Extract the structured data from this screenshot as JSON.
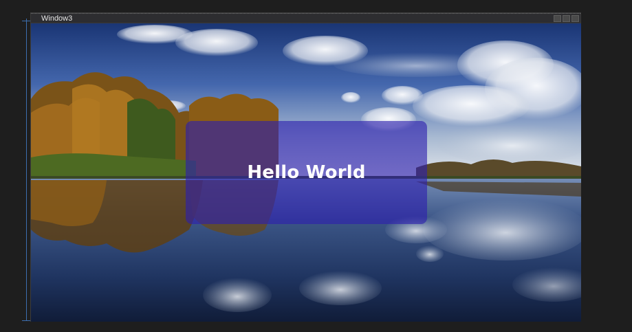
{
  "window": {
    "title": "Window3",
    "controls": [
      "minimize",
      "maximize",
      "close"
    ]
  },
  "content": {
    "message": "Hello World"
  },
  "colors": {
    "app_background": "#1e1e1e",
    "titlebar": "#2d2d30",
    "overlay": "rgba(45,30,175,0.62)",
    "message_text": "#ffffff",
    "guide_line": "#3d6fb0"
  },
  "background_image": {
    "subject": "autumn trees reflected in a lake under a cloudy blue sky"
  }
}
